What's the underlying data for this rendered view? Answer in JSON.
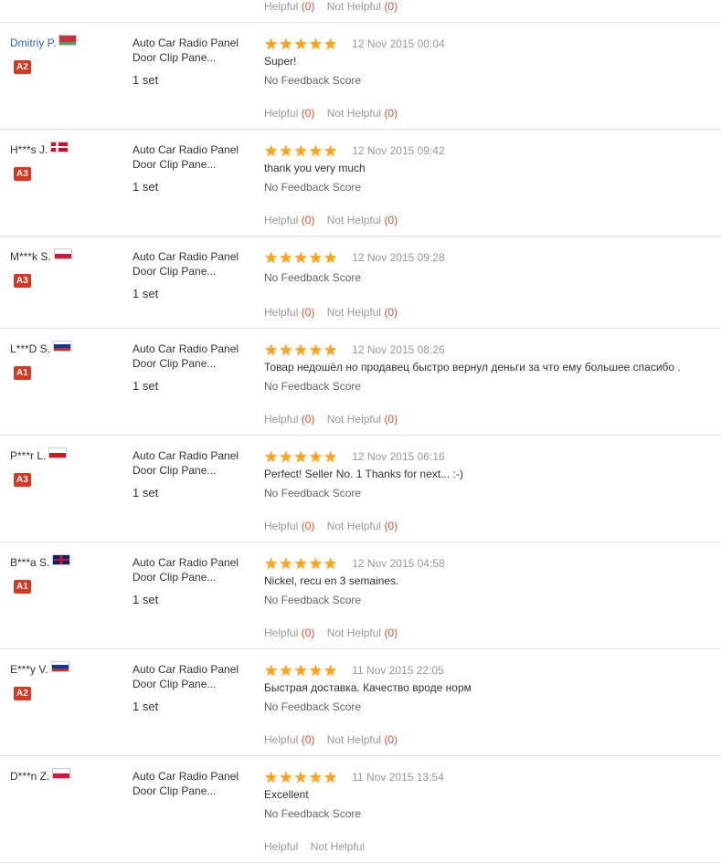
{
  "labels": {
    "helpful": "Helpful",
    "not_helpful": "Not Helpful",
    "no_feedback": "No Feedback Score",
    "star": "★"
  },
  "top_votes": {
    "helpful_count": "(0)",
    "not_helpful_count": "(0)"
  },
  "reviews": [
    {
      "name": "Dmitriy P.",
      "link": true,
      "flag": "by",
      "badge": "A2",
      "product": "Auto Car Radio Panel Door Clip Pane...",
      "qty": "1 set",
      "stars": 5,
      "date": "12 Nov 2015 00:04",
      "comment": "Super!",
      "helpful_count": "(0)",
      "not_helpful_count": "(0)"
    },
    {
      "name": "H***s J.",
      "link": false,
      "flag": "dk",
      "badge": "A3",
      "product": "Auto Car Radio Panel Door Clip Pane...",
      "qty": "1 set",
      "stars": 5,
      "date": "12 Nov 2015 09:42",
      "comment": "thank you very much",
      "helpful_count": "(0)",
      "not_helpful_count": "(0)"
    },
    {
      "name": "M***k S.",
      "link": false,
      "flag": "pl",
      "badge": "A3",
      "product": "Auto Car Radio Panel Door Clip Pane...",
      "qty": "1 set",
      "stars": 5,
      "date": "12 Nov 2015 09:28",
      "comment": "",
      "helpful_count": "(0)",
      "not_helpful_count": "(0)"
    },
    {
      "name": "L***D S.",
      "link": false,
      "flag": "ru",
      "badge": "A1",
      "product": "Auto Car Radio Panel Door Clip Pane...",
      "qty": "1 set",
      "stars": 5,
      "date": "12 Nov 2015 08:26",
      "comment": "Товар недошёл но продавец быстро вернул деньги за что ему большее спасибо .",
      "helpful_count": "(0)",
      "not_helpful_count": "(0)"
    },
    {
      "name": "P***r L.",
      "link": false,
      "flag": "cz",
      "badge": "A3",
      "product": "Auto Car Radio Panel Door Clip Pane...",
      "qty": "1 set",
      "stars": 5,
      "date": "12 Nov 2015 06:16",
      "comment": "Perfect! Seller No. 1 Thanks for next... :-)",
      "helpful_count": "(0)",
      "not_helpful_count": "(0)"
    },
    {
      "name": "B***a S.",
      "link": false,
      "flag": "uk",
      "badge": "A1",
      "product": "Auto Car Radio Panel Door Clip Pane...",
      "qty": "1 set",
      "stars": 5,
      "date": "12 Nov 2015 04:58",
      "comment": "Nickel, recu en 3 semaines.",
      "helpful_count": "(0)",
      "not_helpful_count": "(0)"
    },
    {
      "name": "E***y V.",
      "link": false,
      "flag": "ru",
      "badge": "A2",
      "product": "Auto Car Radio Panel Door Clip Pane...",
      "qty": "1 set",
      "stars": 5,
      "date": "11 Nov 2015 22:05",
      "comment": "Быстрая доставка. Качество вроде норм",
      "helpful_count": "(0)",
      "not_helpful_count": "(0)"
    },
    {
      "name": "D***n Z.",
      "link": false,
      "flag": "pl",
      "badge": "",
      "product": "Auto Car Radio Panel Door Clip Pane...",
      "qty": "",
      "stars": 5,
      "date": "11 Nov 2015 13:54",
      "comment": "Excellent",
      "helpful_count": "",
      "not_helpful_count": ""
    }
  ]
}
